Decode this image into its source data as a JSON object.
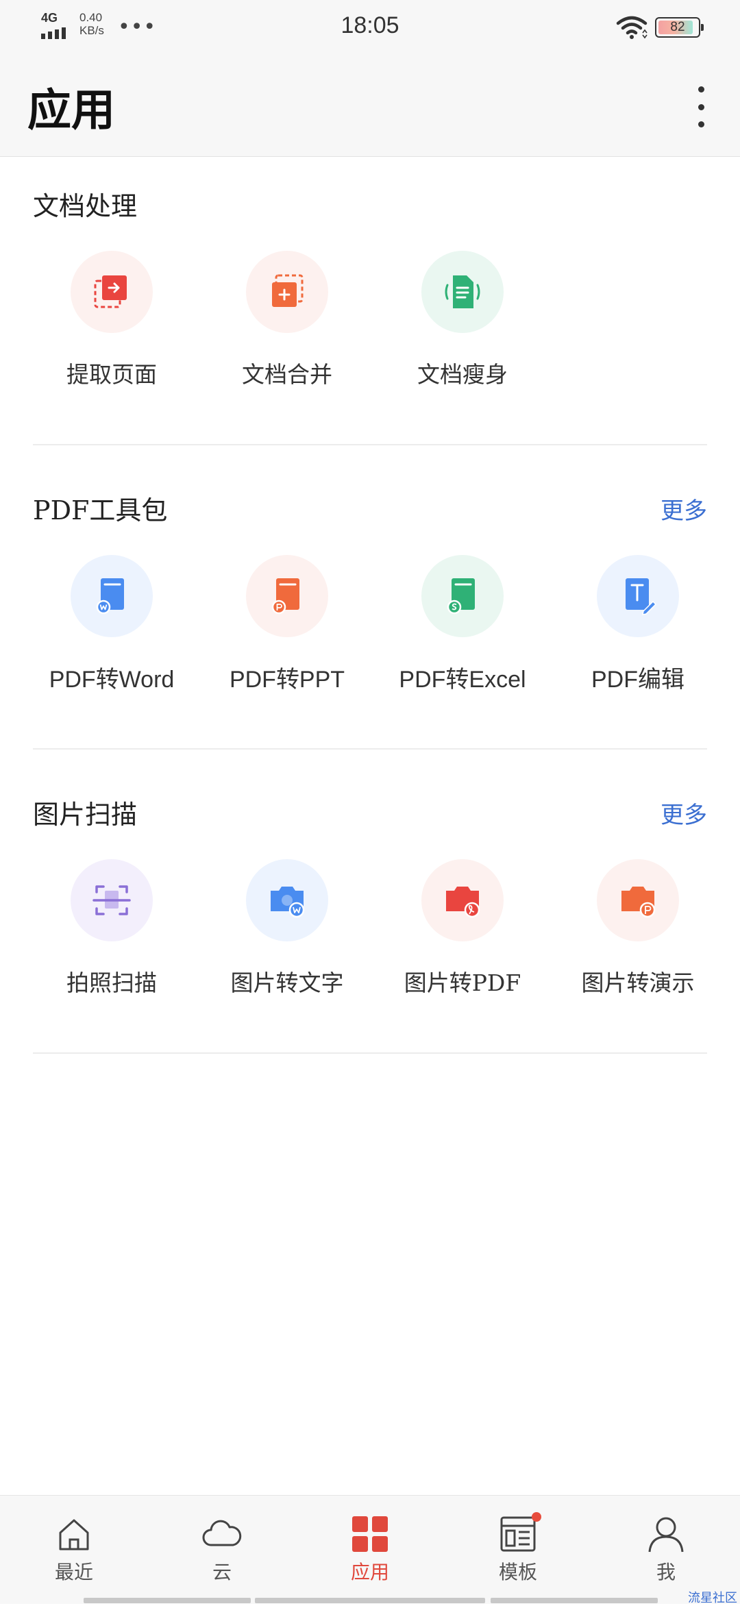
{
  "status_bar": {
    "network": "4G",
    "speed_value": "0.40",
    "speed_unit": "KB/s",
    "time": "18:05",
    "battery": "82"
  },
  "header": {
    "title": "应用"
  },
  "sections": {
    "doc_processing": {
      "title": "文档处理",
      "tools": [
        {
          "label": "提取页面",
          "icon": "extract-page-icon"
        },
        {
          "label": "文档合并",
          "icon": "merge-document-icon"
        },
        {
          "label": "文档瘦身",
          "icon": "slim-document-icon"
        }
      ]
    },
    "pdf_toolkit": {
      "title": "PDF工具包",
      "more": "更多",
      "tools": [
        {
          "label": "PDF转Word",
          "icon": "pdf-to-word-icon"
        },
        {
          "label": "PDF转PPT",
          "icon": "pdf-to-ppt-icon"
        },
        {
          "label": "PDF转Excel",
          "icon": "pdf-to-excel-icon"
        },
        {
          "label": "PDF编辑",
          "icon": "pdf-edit-icon"
        }
      ]
    },
    "image_scan": {
      "title": "图片扫描",
      "more": "更多",
      "tools": [
        {
          "label": "拍照扫描",
          "icon": "photo-scan-icon"
        },
        {
          "label": "图片转文字",
          "icon": "image-to-text-icon"
        },
        {
          "label": "图片转PDF",
          "icon": "image-to-pdf-icon"
        },
        {
          "label": "图片转演示",
          "icon": "image-to-presentation-icon"
        }
      ]
    }
  },
  "bottom_nav": [
    {
      "label": "最近",
      "icon": "home-icon"
    },
    {
      "label": "云",
      "icon": "cloud-icon"
    },
    {
      "label": "应用",
      "icon": "apps-grid-icon",
      "active": true
    },
    {
      "label": "模板",
      "icon": "template-icon",
      "badge": true
    },
    {
      "label": "我",
      "icon": "profile-icon"
    }
  ],
  "watermark": "流星社区",
  "colors": {
    "accent": "#e0483c",
    "link": "#3b6fd1",
    "word_blue": "#4a8cf0",
    "ppt_orange": "#f06a3c",
    "excel_green": "#2fb176",
    "scan_purple": "#8a6fd6",
    "pdf_red": "#e9453f"
  }
}
